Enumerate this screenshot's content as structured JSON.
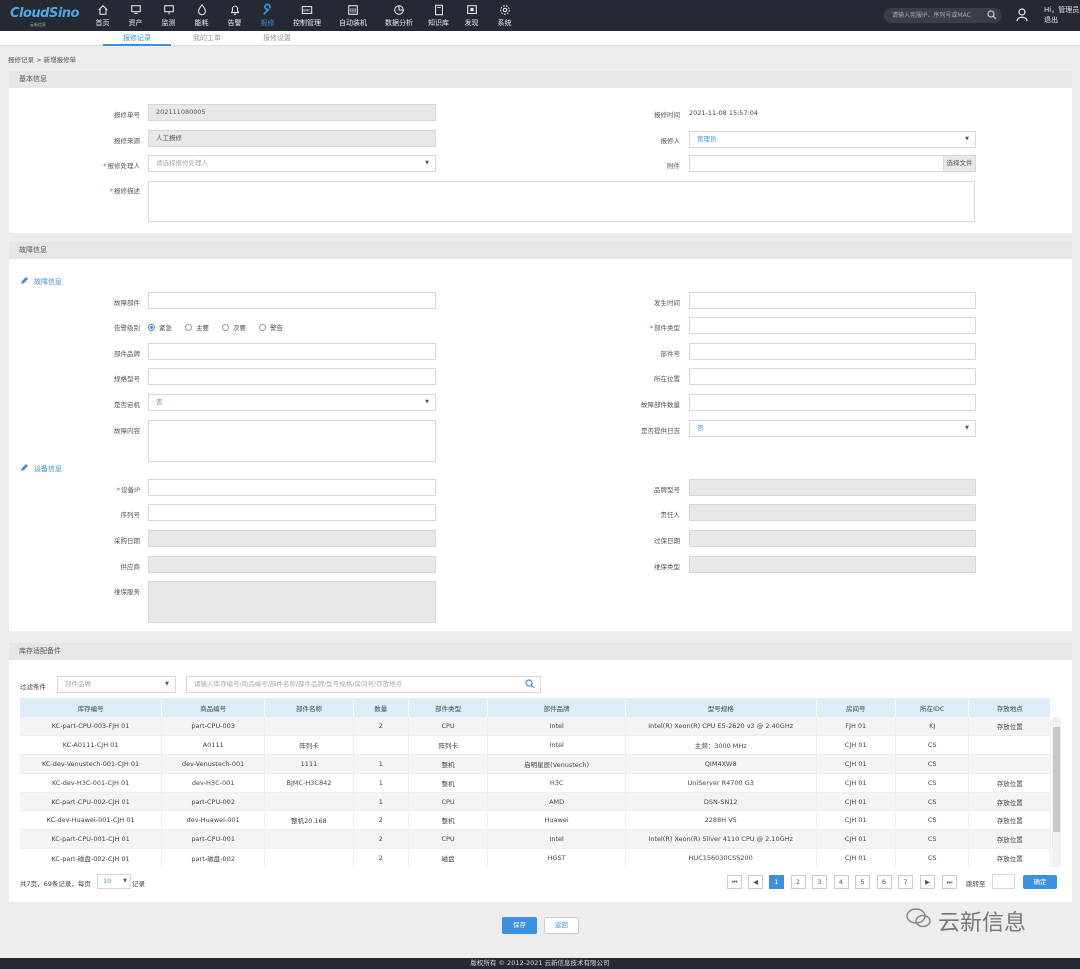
{
  "brand": {
    "logo": "CloudSino",
    "logo_sub": "云新信息"
  },
  "nav": [
    {
      "label": "首页",
      "icon": "home-icon"
    },
    {
      "label": "资产",
      "icon": "server-icon"
    },
    {
      "label": "监测",
      "icon": "monitor-icon"
    },
    {
      "label": "能耗",
      "icon": "drop-icon"
    },
    {
      "label": "告警",
      "icon": "bell-icon"
    },
    {
      "label": "报修",
      "icon": "wrench-icon"
    },
    {
      "label": "控制管理",
      "icon": "bmc-icon"
    },
    {
      "label": "自动装机",
      "icon": "install-icon"
    },
    {
      "label": "数据分析",
      "icon": "pie-icon"
    },
    {
      "label": "知识库",
      "icon": "book-icon"
    },
    {
      "label": "发现",
      "icon": "discover-icon"
    },
    {
      "label": "系统",
      "icon": "gear-icon"
    }
  ],
  "top_search": {
    "placeholder": "请输入宪服IP、序列号或MAC"
  },
  "user": {
    "greeting": "Hi，管理员",
    "logout": "退出"
  },
  "tabs": [
    "报修记录",
    "我的工单",
    "报修设置"
  ],
  "breadcrumb": "报修记录 > 新增报修单",
  "basic": {
    "title": "基本信息",
    "repair_no_label": "报修单号",
    "repair_no": "202111080005",
    "repair_time_label": "报修时间",
    "repair_time": "2021-11-08 15:57:04",
    "source_label": "报修来源",
    "source": "人工报修",
    "reporter_label": "报修人",
    "reporter": "管理员",
    "handler_label": "报修处理人",
    "handler_placeholder": "请选择报修处理人",
    "attachment_label": "附件",
    "attachment_button": "选择文件",
    "desc_label": "报修描述"
  },
  "fault": {
    "title": "故障信息",
    "sub_fault": "故障信息",
    "part_label": "故障部件",
    "occur_time_label": "发生时间",
    "level_label": "告警级别",
    "levels": [
      "紧急",
      "主要",
      "次要",
      "警告"
    ],
    "part_type_label": "部件类型",
    "part_brand_label": "部件品牌",
    "part_no_label": "部件号",
    "spec_label": "规格型号",
    "location_label": "所在位置",
    "down_label": "是否宕机",
    "down_value": "否",
    "fault_count_label": "故障部件数量",
    "content_label": "故障内容",
    "log_label": "是否提供日志",
    "log_value": "否",
    "sub_device": "设备信息",
    "ip_label": "设备IP",
    "brand_model_label": "品牌型号",
    "serial_label": "序列号",
    "owner_label": "责任人",
    "purchase_label": "采购日期",
    "warranty_date_label": "过保日期",
    "supplier_label": "供应商",
    "warranty_type_label": "维保类型",
    "warranty_service_label": "维保服务"
  },
  "stock": {
    "title": "库存适配备件",
    "filter_label": "过滤条件",
    "filter_select": "部件品牌",
    "filter_placeholder": "请输入库存编号/商品编号/部件名称/部件品牌/型号规格/房间号/存放地点",
    "columns": [
      "库存编号",
      "商品编号",
      "部件名称",
      "数量",
      "部件类型",
      "部件品牌",
      "型号规格",
      "房间号",
      "所在IDC",
      "存放地点"
    ],
    "rows": [
      [
        "KC-part-CPU-003-FJH 01",
        "part-CPU-003",
        "",
        "2",
        "CPU",
        "Intel",
        "Intel(R) Xeon(R) CPU E5-2620 v3 @ 2.40GHz",
        "FJH 01",
        "KJ",
        "存放位置"
      ],
      [
        "KC-A0111-CJH 01",
        "A0111",
        "阵列卡",
        "",
        "阵列卡",
        "Intel",
        "主频：3000 MHz",
        "CJH 01",
        "CS",
        ""
      ],
      [
        "KC-dev-Venustech-001-CJH 01",
        "dev-Venustech-001",
        "1111",
        "1",
        "整机",
        "启明星辰(Venustech)",
        "QIM4XW8",
        "CJH 01",
        "CS",
        ""
      ],
      [
        "KC-dev-H3C-001-CJH 01",
        "dev-H3C-001",
        "BJMC-H3C842",
        "1",
        "整机",
        "H3C",
        "UniServer R4700 G3",
        "CJH 01",
        "CS",
        "存放位置"
      ],
      [
        "KC-part-CPU-002-CJH 01",
        "part-CPU-002",
        "",
        "1",
        "CPU",
        "AMD",
        "DSN-SN12",
        "CJH 01",
        "CS",
        "存放位置"
      ],
      [
        "KC-dev-Huawei-001-CJH 01",
        "dev-Huawei-001",
        "整机20.168",
        "2",
        "整机",
        "Huawei",
        "2288H V5",
        "CJH 01",
        "CS",
        "存放位置"
      ],
      [
        "KC-part-CPU-001-CJH 01",
        "part-CPU-001",
        "",
        "2",
        "CPU",
        "Intel",
        "Intel(R) Xeon(R) Silver 4110 CPU @ 2.10GHz",
        "CJH 01",
        "CS",
        "存放位置"
      ],
      [
        "KC-part-磁盘-002-CJH 01",
        "part-磁盘-002",
        "",
        "2",
        "磁盘",
        "HGST",
        "HUC156030CSS200",
        "CJH 01",
        "CS",
        "存放位置"
      ]
    ],
    "pager_text_a": "共7页，69条记录，每页",
    "page_size": "10",
    "pager_text_b": "记录",
    "pages": [
      "1",
      "2",
      "3",
      "4",
      "5",
      "6",
      "7"
    ],
    "first": "⏮",
    "prev": "◀",
    "next": "▶",
    "last": "⏭",
    "jump_label": "跳转至",
    "confirm": "确定"
  },
  "actions": {
    "save": "保存",
    "back": "返回"
  },
  "footer": "版权所有 © 2012-2021  云新信息技术有限公司",
  "watermark": "云新信息",
  "colors": {
    "accent": "#3d8fe0",
    "topbar": "#252931"
  }
}
